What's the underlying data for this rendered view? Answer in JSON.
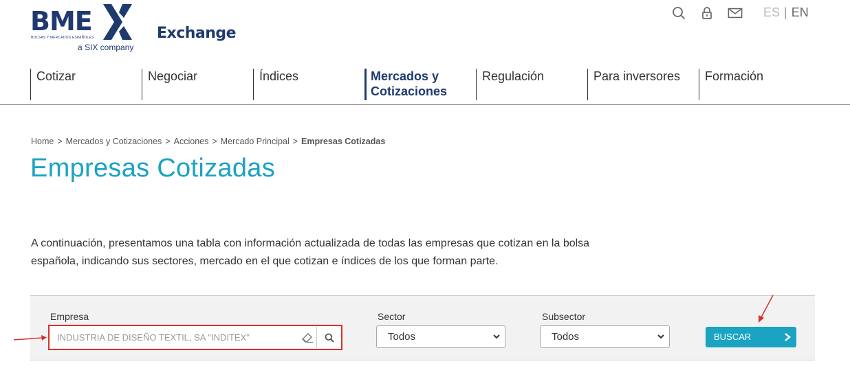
{
  "header": {
    "logo_text": "BME",
    "logo_sub": "BOLSAS Y MERCADOS ESPAÑOLES",
    "logo_tagline": "a SIX company",
    "exchange_label": "Exchange",
    "icons": [
      "search-icon",
      "lock-icon",
      "mail-icon"
    ],
    "lang": {
      "es": "ES",
      "separator": "|",
      "en": "EN"
    }
  },
  "nav": {
    "items": [
      {
        "label": "Cotizar",
        "active": false
      },
      {
        "label": "Negociar",
        "active": false
      },
      {
        "label": "Índices",
        "active": false
      },
      {
        "label": "Mercados y Cotizaciones",
        "line1": "Mercados y",
        "line2": "Cotizaciones",
        "active": true
      },
      {
        "label": "Regulación",
        "active": false
      },
      {
        "label": "Para inversores",
        "active": false
      },
      {
        "label": "Formación",
        "active": false
      }
    ]
  },
  "breadcrumb": {
    "items": [
      "Home",
      "Mercados y Cotizaciones",
      "Acciones",
      "Mercado Principal"
    ],
    "separator": ">",
    "current": "Empresas Cotizadas"
  },
  "page": {
    "title": "Empresas Cotizadas",
    "intro_line1": "A continuación, presentamos una tabla con información actualizada de todas las empresas que cotizan en la bolsa",
    "intro_line2": "española, indicando sus sectores, mercado en el que cotizan e índices de los que forman parte."
  },
  "filters": {
    "empresa_label": "Empresa",
    "empresa_placeholder": "INDUSTRIA DE DISEÑO TEXTIL, SA \"INDITEX\"",
    "sector_label": "Sector",
    "sector_value": "Todos",
    "subsector_label": "Subsector",
    "subsector_value": "Todos",
    "search_button": "BUSCAR"
  },
  "colors": {
    "brand_navy": "#1f3a6e",
    "accent_teal": "#1aa3c2",
    "annotation_red": "#d9302b"
  }
}
